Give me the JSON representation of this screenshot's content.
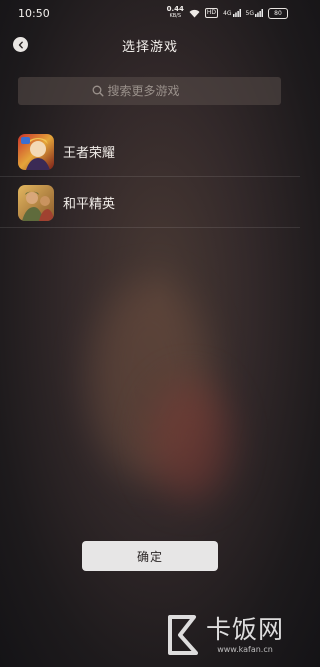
{
  "status_bar": {
    "time": "10:50",
    "net_speed_value": "0.44",
    "net_speed_unit": "KB/S",
    "hd_label": "HD",
    "signal_4g_label": "4G",
    "signal_5g_label": "5G",
    "battery": "80"
  },
  "header": {
    "title": "选择游戏"
  },
  "search": {
    "placeholder": "搜索更多游戏"
  },
  "games": [
    {
      "name": "王者荣耀",
      "icon": "honor-of-kings-icon"
    },
    {
      "name": "和平精英",
      "icon": "game-for-peace-icon"
    }
  ],
  "footer": {
    "confirm_label": "确定"
  },
  "watermark": {
    "brand": "卡饭网",
    "url": "www.kafan.cn"
  }
}
